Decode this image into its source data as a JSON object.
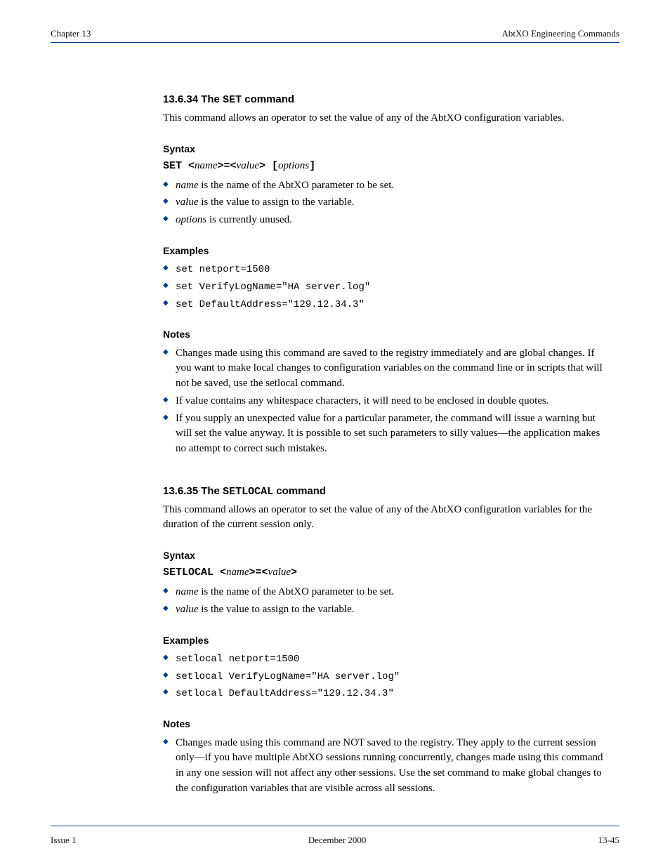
{
  "header": {
    "left": "Chapter 13",
    "right": "AbtXO Engineering Commands"
  },
  "footer": {
    "left": "Issue 1",
    "center": "December 2000",
    "right": "13-45"
  },
  "sec1": {
    "title_prefix": "13.6.34 The ",
    "title_cmd": "SET",
    "title_suffix": " command",
    "desc": "This command allows an operator to set the value of any of the AbtXO configuration variables.",
    "syntax_label": "Syntax",
    "syntax": {
      "cmd": "SET <",
      "p1": "name",
      "mid1": ">=<",
      "p2": "value",
      "mid2": "> [",
      "p3": "options",
      "end": "]"
    },
    "bullets1": [
      {
        "arg": "name",
        "text": " is the name of the AbtXO parameter to be set."
      },
      {
        "arg": "value",
        "text": " is the value to assign to the variable."
      },
      {
        "arg": "options",
        "text": " is currently unused."
      }
    ],
    "examples_label": "Examples",
    "examples": [
      "set netport=1500",
      "set VerifyLogName=\"HA server.log\"",
      "set DefaultAddress=\"129.12.34.3\""
    ],
    "notes_label": "Notes",
    "notes": [
      "Changes made using this command are saved to the registry immediately and are global changes. If you want to make local changes to configuration variables on the command line or in scripts that will not be saved, use the setlocal command.",
      "If value contains any whitespace characters, it will need to be enclosed in double quotes.",
      "If you supply an unexpected value for a particular parameter, the command will issue a warning but will set the value anyway. It is possible to set such parameters to silly values—the application makes no attempt to correct such mistakes."
    ]
  },
  "sec2": {
    "title_prefix": "13.6.35 The ",
    "title_cmd": "SETLOCAL",
    "title_suffix": " command",
    "desc": "This command allows an operator to set the value of any of the AbtXO configuration variables for the duration of the current session only.",
    "syntax_label": "Syntax",
    "syntax": {
      "cmd": "SETLOCAL <",
      "p1": "name",
      "mid1": ">=<",
      "p2": "value",
      "end": ">"
    },
    "bullets1": [
      {
        "arg": "name",
        "text": " is the name of the AbtXO parameter to be set."
      },
      {
        "arg": "value",
        "text": " is the value to assign to the variable."
      }
    ],
    "examples_label": "Examples",
    "examples": [
      "setlocal netport=1500",
      "setlocal VerifyLogName=\"HA server.log\"",
      "setlocal DefaultAddress=\"129.12.34.3\""
    ],
    "notes_label": "Notes",
    "notes": [
      "Changes made using this command are NOT saved to the registry. They apply to the current session only—if you have multiple AbtXO sessions running concurrently, changes made using this command in any one session will not affect any other sessions. Use the set command to make global changes to the configuration variables that are visible across all sessions."
    ]
  }
}
